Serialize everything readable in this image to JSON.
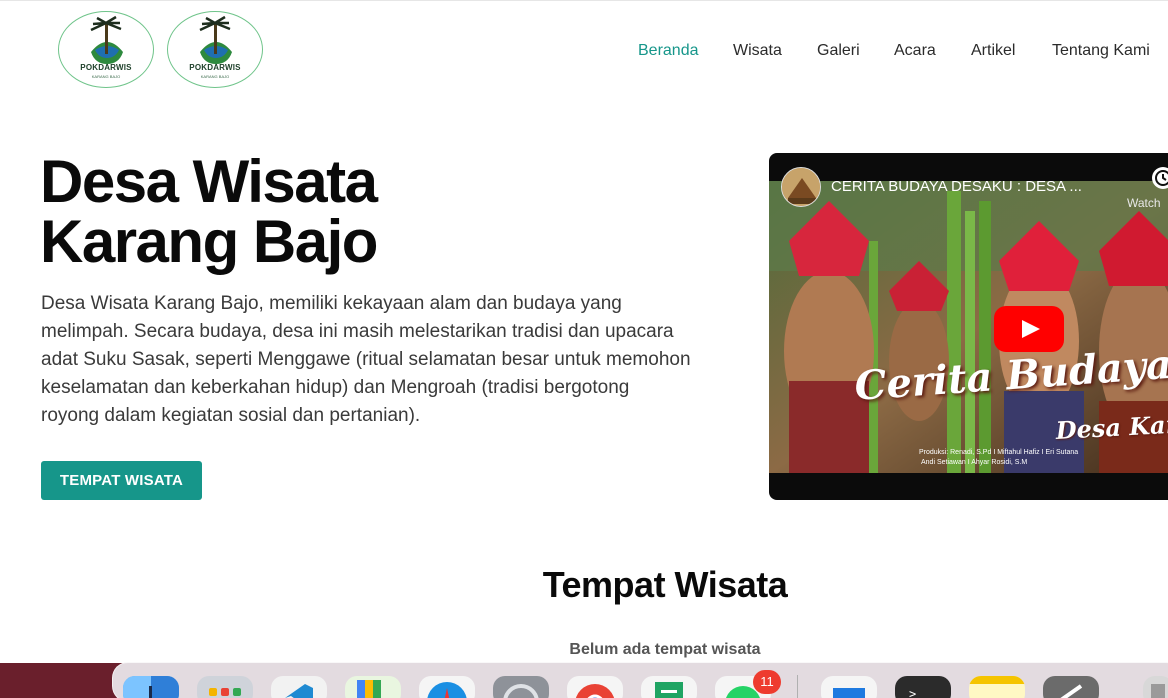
{
  "header": {
    "logos": [
      {
        "name": "POKDARWIS",
        "sub": "KARANG BAJO"
      },
      {
        "name": "POKDARWIS",
        "sub": "KARANG BAJO"
      }
    ],
    "nav": [
      {
        "label": "Beranda",
        "active": true
      },
      {
        "label": "Wisata",
        "active": false
      },
      {
        "label": "Galeri",
        "active": false
      },
      {
        "label": "Acara",
        "active": false
      },
      {
        "label": "Artikel",
        "active": false
      },
      {
        "label": "Tentang Kami",
        "active": false
      }
    ]
  },
  "hero": {
    "title_line1": "Desa Wisata",
    "title_line2": "Karang Bajo",
    "description": "Desa Wisata Karang Bajo, memiliki kekayaan alam dan budaya yang melimpah. Secara budaya, desa ini masih melestarikan tradisi dan upacara adat Suku Sasak, seperti Menggawe (ritual selamatan besar untuk memohon keselamatan dan keberkahan hidup) dan Mengroah (tradisi bergotong royong dalam kegiatan sosial dan pertanian).",
    "cta_label": "TEMPAT WISATA"
  },
  "video": {
    "title": "CERITA BUDAYA DESAKU : DESA ...",
    "watch_label": "Watch",
    "overlay_title": "Cerita Budaya Desak",
    "overlay_sub": "Desa Karang B",
    "credits_line1": "Produksi: Renadi, S.Pd I Miftahul Hafiz I Eri Sutana",
    "credits_line2": "Andi Setiawan I Ahyar Rosidi, S.M"
  },
  "section": {
    "title": "Tempat Wisata",
    "empty_note": "Belum ada tempat wisata"
  },
  "dock": {
    "apps": [
      "finder-icon",
      "launchpad-icon",
      "vscode-icon",
      "maps-icon",
      "safari-icon",
      "settings-icon",
      "chrome-icon",
      "sheets-icon",
      "whatsapp-icon",
      "mail-icon",
      "terminal-icon",
      "notes-icon",
      "creative-icon",
      "trash-icon"
    ],
    "whatsapp_badge": "11"
  },
  "colors": {
    "accent": "#16968a",
    "play": "#ff0000",
    "dock_bg": "#6a1f2c"
  }
}
